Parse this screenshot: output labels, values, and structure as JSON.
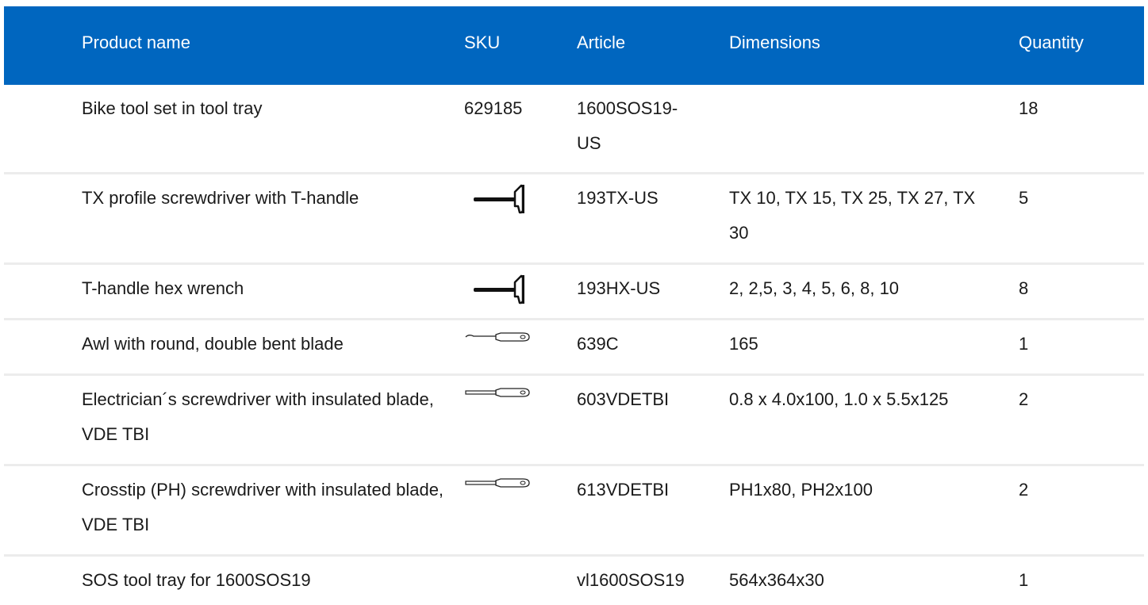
{
  "table": {
    "columns": {
      "name": "Product name",
      "sku": "SKU",
      "article": "Article",
      "dimensions": "Dimensions",
      "quantity": "Quantity"
    },
    "rows": [
      {
        "name": "Bike tool set in tool tray",
        "sku": "629185",
        "article": "1600SOS19-\nUS",
        "dimensions": "",
        "quantity": "18"
      },
      {
        "name": "TX profile screwdriver with T-handle",
        "sku_icon": "t-handle-tool-icon",
        "article": "193TX-US",
        "dimensions": "TX 10, TX 15, TX 25, TX 27, TX 30",
        "quantity": "5"
      },
      {
        "name": "T-handle hex wrench",
        "sku_icon": "t-handle-tool-icon",
        "article": "193HX-US",
        "dimensions": "2, 2,5, 3, 4, 5, 6, 8, 10",
        "quantity": "8"
      },
      {
        "name": "Awl with round, double bent blade",
        "sku_icon": "awl-icon",
        "article": "639C",
        "dimensions": "165",
        "quantity": "1"
      },
      {
        "name": "Electrician´s screwdriver with insulated blade, VDE TBI",
        "sku_icon": "screwdriver-icon",
        "article": "603VDETBI",
        "dimensions": "0.8 x 4.0x100, 1.0 x 5.5x125",
        "quantity": "2"
      },
      {
        "name": "Crosstip (PH) screwdriver with insulated blade, VDE TBI",
        "sku_icon": "screwdriver-icon",
        "article": "613VDETBI",
        "dimensions": "PH1x80, PH2x100",
        "quantity": "2"
      },
      {
        "name": "SOS tool tray for 1600SOS19",
        "sku": "",
        "article": "vl1600SOS19",
        "dimensions": "564x364x30",
        "quantity": "1"
      }
    ]
  },
  "colors": {
    "header_bg": "#0066bf",
    "header_text": "#ffffff",
    "row_divider": "#ececec"
  }
}
